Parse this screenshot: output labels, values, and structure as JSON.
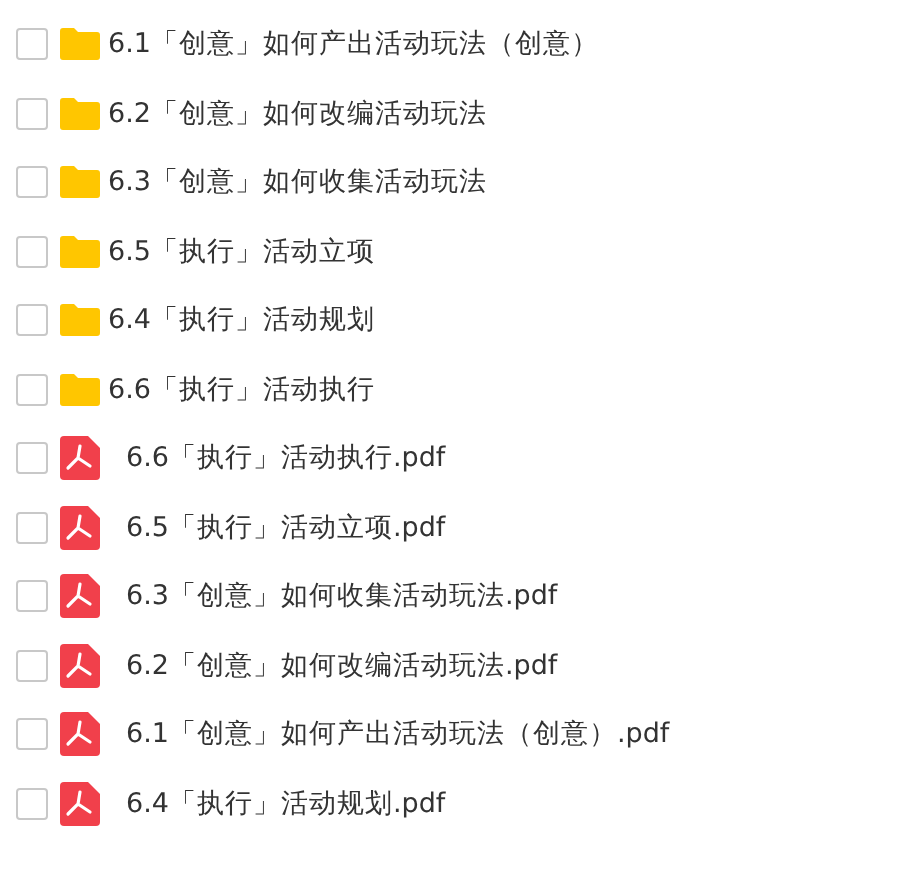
{
  "files": [
    {
      "kind": "folder",
      "name": "6.1「创意」如何产出活动玩法（创意）",
      "checked": false
    },
    {
      "kind": "folder",
      "name": "6.2「创意」如何改编活动玩法",
      "checked": false
    },
    {
      "kind": "folder",
      "name": "6.3「创意」如何收集活动玩法",
      "checked": false
    },
    {
      "kind": "folder",
      "name": "6.5「执行」活动立项",
      "checked": false
    },
    {
      "kind": "folder",
      "name": "6.4「执行」活动规划",
      "checked": false
    },
    {
      "kind": "folder",
      "name": "6.6「执行」活动执行",
      "checked": false
    },
    {
      "kind": "pdf",
      "name": "6.6「执行」活动执行.pdf",
      "checked": false
    },
    {
      "kind": "pdf",
      "name": "6.5「执行」活动立项.pdf",
      "checked": false
    },
    {
      "kind": "pdf",
      "name": "6.3「创意」如何收集活动玩法.pdf",
      "checked": false
    },
    {
      "kind": "pdf",
      "name": "6.2「创意」如何改编活动玩法.pdf",
      "checked": false
    },
    {
      "kind": "pdf",
      "name": "6.1「创意」如何产出活动玩法（创意）.pdf",
      "checked": false
    },
    {
      "kind": "pdf",
      "name": "6.4「执行」活动规划.pdf",
      "checked": false
    }
  ]
}
